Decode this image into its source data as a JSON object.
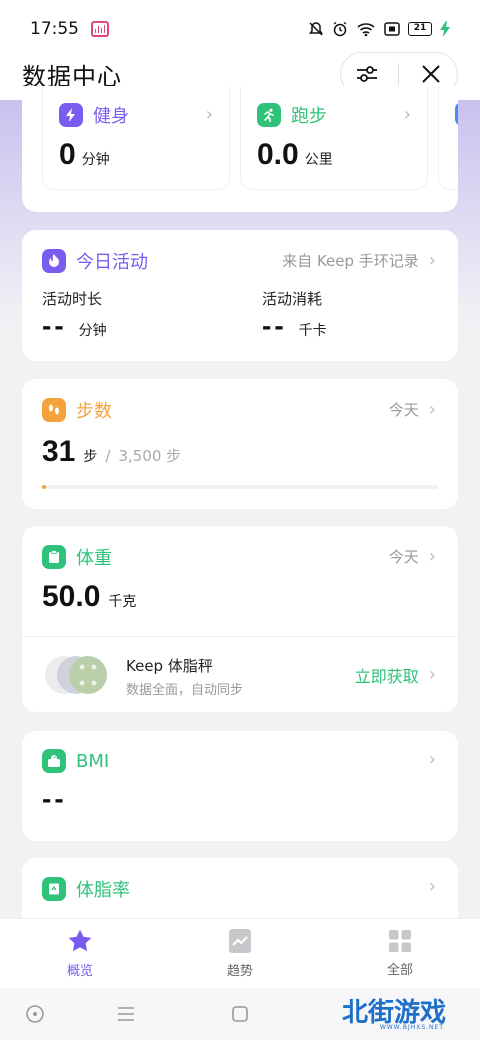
{
  "status_bar": {
    "time": "17:55",
    "battery": "21"
  },
  "header": {
    "title": "数据中心"
  },
  "top_cards": [
    {
      "label": "健身",
      "value": "0",
      "unit": "分钟",
      "color": "#7b5cf0"
    },
    {
      "label": "跑步",
      "value": "0.0",
      "unit": "公里",
      "color": "#2fc27a"
    }
  ],
  "activity": {
    "title": "今日活动",
    "source": "来自 Keep 手环记录",
    "duration_label": "活动时长",
    "duration_value": "--",
    "duration_unit": "分钟",
    "burn_label": "活动消耗",
    "burn_value": "--",
    "burn_unit": "千卡",
    "color": "#7b5cf0"
  },
  "steps": {
    "title": "步数",
    "date": "今天",
    "value": "31",
    "unit": "步",
    "separator": "/",
    "goal": "3,500 步",
    "progress": 0.009,
    "color": "#f5a23c"
  },
  "weight": {
    "title": "体重",
    "date": "今天",
    "value": "50.0",
    "unit": "千克",
    "promo_title": "Keep 体脂秤",
    "promo_subtitle": "数据全面，自动同步",
    "promo_action": "立即获取",
    "color": "#2fc27a"
  },
  "bmi": {
    "title": "BMI",
    "value": "--",
    "color": "#2fc27a"
  },
  "bodyfat": {
    "title": "体脂率",
    "color": "#2fc27a"
  },
  "bottom_nav": [
    {
      "label": "概览",
      "icon": "star-icon",
      "active": true
    },
    {
      "label": "趋势",
      "icon": "trend-icon",
      "active": false
    },
    {
      "label": "全部",
      "icon": "grid-icon",
      "active": false
    }
  ],
  "watermark": {
    "brand": "北街游戏",
    "url": "WWW.BJHXS.NET"
  }
}
